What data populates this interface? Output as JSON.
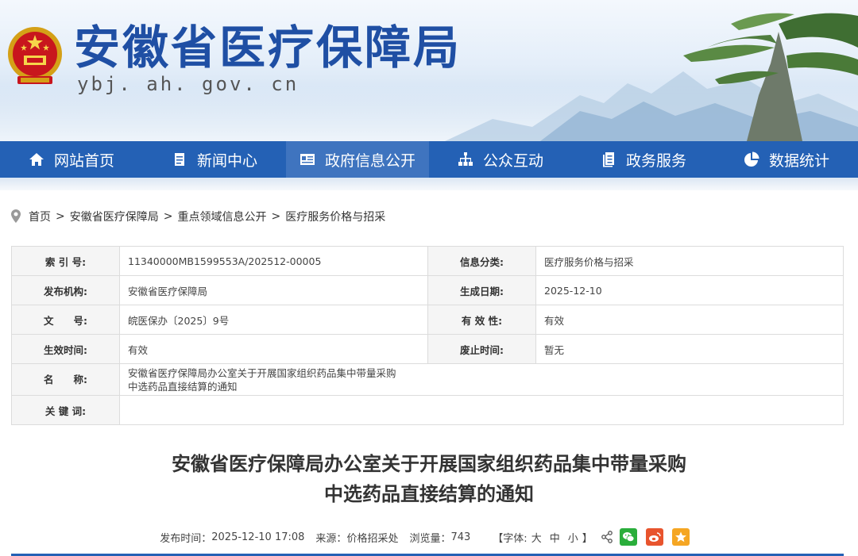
{
  "header": {
    "title": "安徽省医疗保障局",
    "domain": "ybj. ah. gov. cn",
    "emblem_icon": "national-emblem-icon",
    "brand_color": "#1f4fa4"
  },
  "nav": {
    "items": [
      {
        "label": "网站首页",
        "icon": "home-icon"
      },
      {
        "label": "新闻中心",
        "icon": "document-icon"
      },
      {
        "label": "政府信息公开",
        "icon": "news-panel-icon",
        "active": true
      },
      {
        "label": "公众互动",
        "icon": "org-chart-icon"
      },
      {
        "label": "政务服务",
        "icon": "files-icon"
      },
      {
        "label": "数据统计",
        "icon": "pie-chart-icon"
      }
    ],
    "color": "#2461b5"
  },
  "breadcrumb": {
    "icon": "location-pin-icon",
    "items": [
      "首页",
      "安徽省医疗保障局",
      "重点领域信息公开",
      "医疗服务价格与招采"
    ],
    "separator": ">"
  },
  "info": {
    "index_label": "索 引 号:",
    "index_value": "11340000MB1599553A/202512-00005",
    "category_label": "信息分类:",
    "category_value": "医疗服务价格与招采",
    "publisher_label": "发布机构:",
    "publisher_value": "安徽省医疗保障局",
    "date_label": "生成日期:",
    "date_value": "2025-12-10",
    "doc_no_label": "文　　号:",
    "doc_no_value": "皖医保办〔2025〕9号",
    "validity_label": "有 效 性:",
    "validity_value": "有效",
    "effective_label": "生效时间:",
    "effective_value": "有效",
    "expiry_label": "废止时间:",
    "expiry_value": "暂无",
    "name_label": "名　　称:",
    "name_line1": "安徽省医疗保障局办公室关于开展国家组织药品集中带量采购",
    "name_line2": "中选药品直接结算的通知",
    "keywords_label": "关 键 词:",
    "keywords_value": ""
  },
  "article": {
    "title_line1": "安徽省医疗保障局办公室关于开展国家组织药品集中带量采购",
    "title_line2": "中选药品直接结算的通知",
    "publish_label": "发布时间：",
    "publish_time": "2025-12-10 17:08",
    "source_label": "来源：",
    "source": "价格招采处",
    "views_label": "浏览量：",
    "views": "743",
    "font_open": "【字体:",
    "font_large": "大",
    "font_medium": "中",
    "font_small": "小",
    "font_close": "】",
    "share_icons": [
      "share-icon",
      "wechat-icon",
      "weibo-icon",
      "favorite-icon"
    ]
  }
}
